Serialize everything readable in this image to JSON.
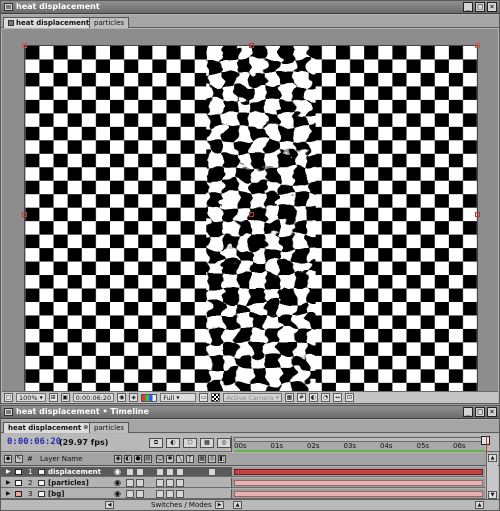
{
  "comp_window": {
    "title": "heat displacement",
    "tabs": [
      {
        "label": "heat displacement",
        "active": true
      },
      {
        "label": "particles",
        "active": false
      }
    ]
  },
  "viewer_bar": {
    "zoom": "100%",
    "timecode": "0:00:06:20",
    "resolution": "Full",
    "camera": "Active Camera"
  },
  "timeline_window": {
    "title": "heat displacement • Timeline",
    "tabs": [
      {
        "label": "heat displacement",
        "active": true
      },
      {
        "label": "particles",
        "active": false
      }
    ],
    "current_time": "0:00:06:20",
    "fps": "(29.97 fps)",
    "column_header": "Layer Name",
    "ruler_ticks": [
      "00s",
      "01s",
      "02s",
      "03s",
      "04s",
      "05s",
      "06s"
    ],
    "layers": [
      {
        "num": "1",
        "name": "displacement",
        "selected": true,
        "label_color": "#ffffff"
      },
      {
        "num": "2",
        "name": "[particles]",
        "selected": false,
        "label_color": "#ffffff"
      },
      {
        "num": "3",
        "name": "[bg]",
        "selected": false,
        "label_color": "#f4a3a3"
      }
    ],
    "mode_label": "Switches / Modes"
  },
  "colors": {
    "timecode_blue": "#2b2bb0",
    "layer_bar_selected": "#c7403f",
    "layer_bar": "#e7b2b2",
    "work_area_green": "#59b54a"
  }
}
